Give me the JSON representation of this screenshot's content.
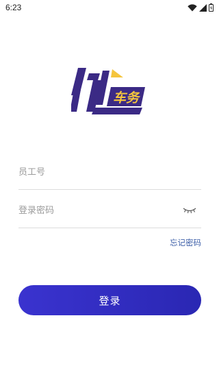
{
  "status_bar": {
    "time": "6:23"
  },
  "logo": {
    "text": "车务"
  },
  "form": {
    "employee_placeholder": "员工号",
    "employee_value": "",
    "password_placeholder": "登录密码",
    "password_value": "",
    "forgot_label": "忘记密码",
    "login_label": "登录"
  },
  "colors": {
    "primary": "#2f2ec4",
    "logo_purple": "#3b2a85",
    "logo_yellow": "#f5c53d",
    "link": "#3d5fa8"
  },
  "icons": [
    "wifi-icon",
    "signal-icon",
    "battery-icon",
    "eye-closed-icon"
  ]
}
